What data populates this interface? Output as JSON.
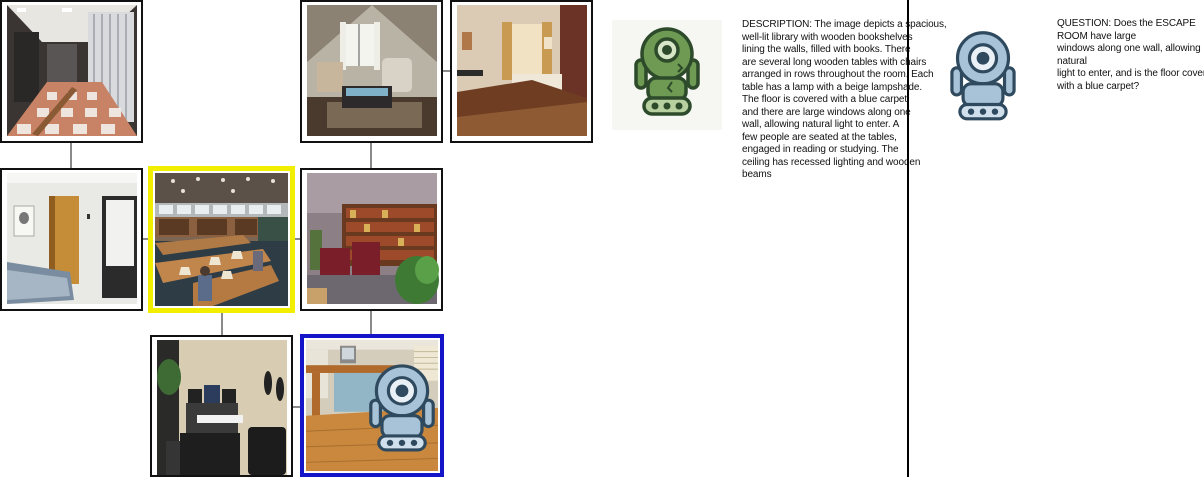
{
  "rooms": [
    {
      "id": "locker-room",
      "scene": "locker-room"
    },
    {
      "id": "attic-living-room",
      "scene": "attic-living-room"
    },
    {
      "id": "hotel-room",
      "scene": "hotel-room"
    },
    {
      "id": "bedroom",
      "scene": "bedroom"
    },
    {
      "id": "library",
      "scene": "library",
      "highlight": "current"
    },
    {
      "id": "library-bookshelves",
      "scene": "library-bookshelves"
    },
    {
      "id": "music-studio",
      "scene": "music-studio"
    },
    {
      "id": "office-with-robot",
      "scene": "office",
      "highlight": "agent"
    }
  ],
  "colors": {
    "current_room_border": "#f2ee00",
    "agent_room_border": "#1414c8",
    "robot_green": "#6e9a53",
    "robot_blue": "#a8c3d8"
  },
  "icons": [
    "robot-green-icon",
    "robot-blue-icon"
  ],
  "description": {
    "lines": [
      "DESCRIPTION: The image depicts a spacious,",
      "well-lit library with wooden bookshelves",
      "lining the walls, filled with books. There",
      "are several long wooden tables with chairs",
      "arranged in rows throughout the room. Each",
      "table has a lamp with a beige lampshade.",
      "The floor is covered with a blue carpet,",
      "and there are large windows along one",
      "wall, allowing natural light to enter. A",
      "few people are seated at the tables,",
      "engaged in reading or studying. The",
      "ceiling has recessed lighting and wooden",
      "beams"
    ]
  },
  "question": {
    "lines": [
      "QUESTION: Does the ESCAPE ROOM have large",
      "windows along one wall, allowing natural",
      "light to enter, and is the floor covered",
      "with a blue carpet?"
    ]
  }
}
